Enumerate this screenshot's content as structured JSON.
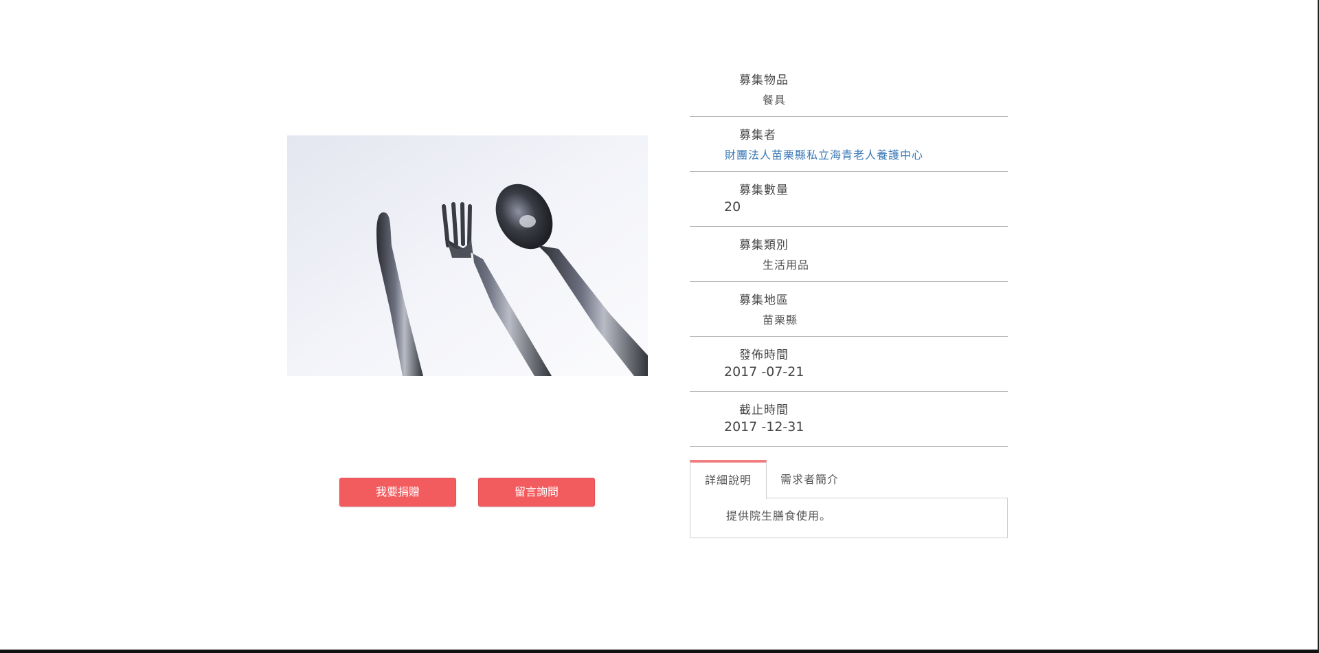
{
  "fields": {
    "item": {
      "label": "募集物品",
      "value": "餐具"
    },
    "collector": {
      "label": "募集者",
      "value": "財團法人苗栗縣私立海青老人養護中心"
    },
    "quantity": {
      "label": "募集數量",
      "value": "20"
    },
    "category": {
      "label": "募集類別",
      "value": "生活用品"
    },
    "region": {
      "label": "募集地區",
      "value": "苗栗縣"
    },
    "published": {
      "label": "發佈時間",
      "value": "2017 -07-21"
    },
    "deadline": {
      "label": "截止時間",
      "value": "2017 -12-31"
    }
  },
  "buttons": {
    "donate": "我要捐贈",
    "ask": "留言詢問"
  },
  "tabs": [
    {
      "label": "詳細說明",
      "active": true
    },
    {
      "label": "需求者簡介",
      "active": false
    }
  ],
  "tab_content": "提供院生膳食使用。",
  "colors": {
    "button": "#f35c5f",
    "link": "#3a78b5",
    "tab_accent": "#f07e80"
  }
}
